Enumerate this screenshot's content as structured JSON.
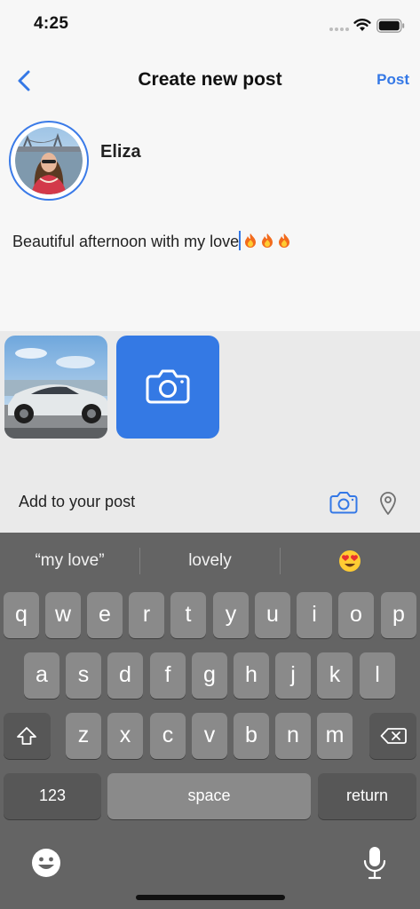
{
  "status_bar": {
    "time": "4:25"
  },
  "nav": {
    "title": "Create new post",
    "post_label": "Post",
    "back_icon": "chevron-left-icon"
  },
  "author": {
    "name": "Eliza"
  },
  "post": {
    "text_before_caret": "Beautiful afternoon with my love",
    "emoji_after_caret": "fire fire fire"
  },
  "media": {
    "add_photo_icon": "camera-icon"
  },
  "add_to_post": {
    "label": "Add to your post",
    "icons": [
      "camera-icon",
      "location-pin-icon"
    ]
  },
  "keyboard": {
    "suggestions": [
      "“my love”",
      "lovely",
      "😍"
    ],
    "row1": [
      "q",
      "w",
      "e",
      "r",
      "t",
      "y",
      "u",
      "i",
      "o",
      "p"
    ],
    "row2": [
      "a",
      "s",
      "d",
      "f",
      "g",
      "h",
      "j",
      "k",
      "l"
    ],
    "row3": [
      "z",
      "x",
      "c",
      "v",
      "b",
      "n",
      "m"
    ],
    "numbers_label": "123",
    "space_label": "space",
    "return_label": "return"
  },
  "colors": {
    "accent": "#3478e6",
    "camera_tile": "#3479e4",
    "keyboard_bg": "#646464",
    "key_bg": "#8a8a8a"
  }
}
